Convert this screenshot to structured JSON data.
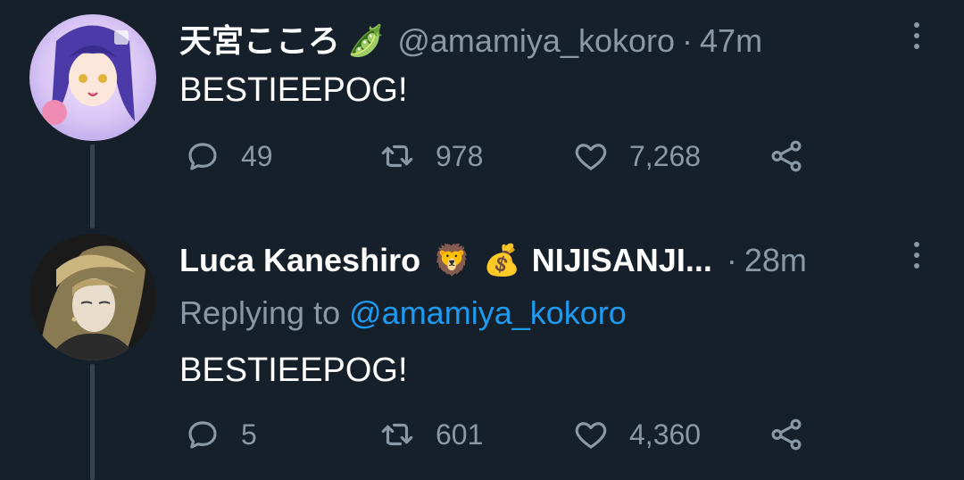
{
  "colors": {
    "background": "#15202b",
    "secondary_text": "#8b98a5",
    "link": "#1d9bf0",
    "thread_line": "#38444d"
  },
  "tweets": [
    {
      "display_name": "天宮こころ",
      "name_emoji": "🫛",
      "handle": "@amamiya_kokoro",
      "separator": "·",
      "time": "47m",
      "text": "BESTIEEPOG!",
      "reply_count": "49",
      "retweet_count": "978",
      "like_count": "7,268",
      "icons": [
        "reply-icon",
        "retweet-icon",
        "like-icon",
        "share-icon",
        "more-icon"
      ]
    },
    {
      "display_name": "Luca Kaneshiro",
      "name_emoji_1": "🦁",
      "name_emoji_2": "💰",
      "name_suffix": "NIJISANJI...",
      "separator": "·",
      "time": "28m",
      "replying_prefix": "Replying to",
      "replying_handle": "@amamiya_kokoro",
      "text": "BESTIEEPOG!",
      "reply_count": "5",
      "retweet_count": "601",
      "like_count": "4,360",
      "icons": [
        "reply-icon",
        "retweet-icon",
        "like-icon",
        "share-icon",
        "more-icon"
      ]
    }
  ]
}
